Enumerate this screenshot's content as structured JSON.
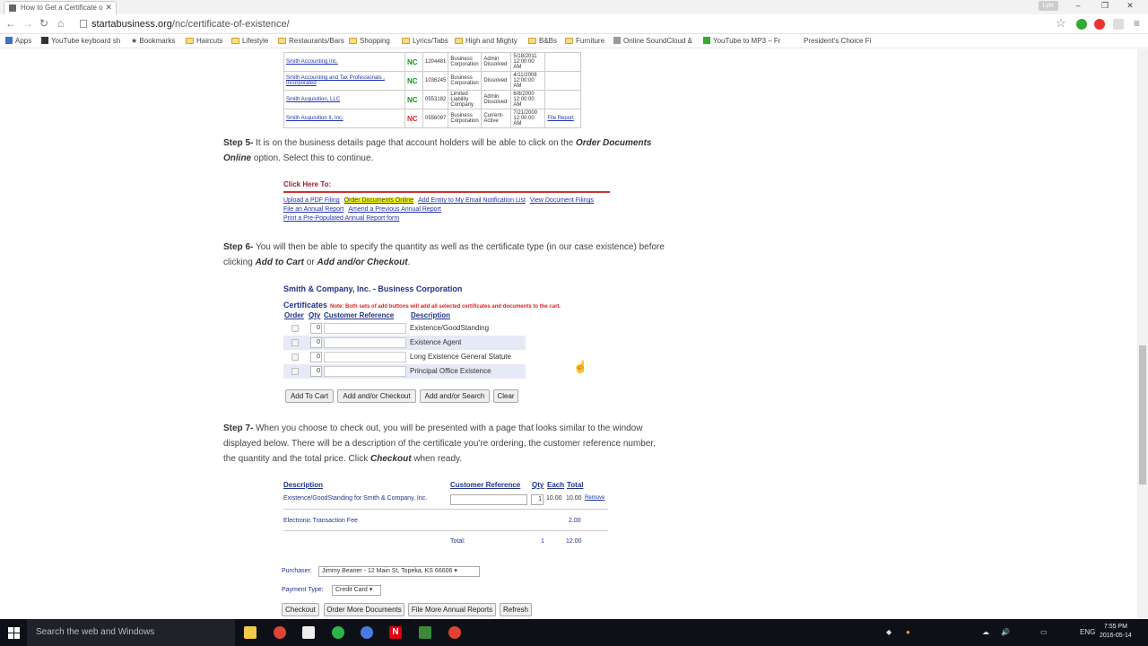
{
  "browser": {
    "tab_title": "How to Get a Certificate o",
    "tab_close": "✕",
    "window_user": "Lyle",
    "url_host": "startabusiness.org",
    "url_path": "/nc/certificate-of-existence/",
    "back_icon": "←",
    "forward_icon": "→",
    "reload_icon": "↻",
    "home_icon": "⌂",
    "star_icon": "☆",
    "menu_icon": "≡",
    "min_icon": "–",
    "max_icon": "❐",
    "close_icon": "✕"
  },
  "bookmarks": [
    {
      "label": "Apps",
      "icon": "apps-icon"
    },
    {
      "label": "YouTube keyboard sh",
      "icon": "youtube-icon"
    },
    {
      "label": "Bookmarks",
      "icon": "star-icon"
    },
    {
      "label": "Haircuts",
      "icon": "folder-icon"
    },
    {
      "label": "Lifestyle",
      "icon": "folder-icon"
    },
    {
      "label": "Restaurants/Bars",
      "icon": "folder-icon"
    },
    {
      "label": "Shopping",
      "icon": "folder-icon"
    },
    {
      "label": "Lyrics/Tabs",
      "icon": "folder-icon"
    },
    {
      "label": "High and Mighty",
      "icon": "folder-icon"
    },
    {
      "label": "B&Bs",
      "icon": "folder-icon"
    },
    {
      "label": "Furniture",
      "icon": "folder-icon"
    },
    {
      "label": "Online SoundCloud &",
      "icon": "page-icon"
    },
    {
      "label": "YouTube to MP3 – Fr",
      "icon": "page-icon"
    },
    {
      "label": "President's Choice Fi",
      "icon": "page-icon"
    }
  ],
  "results_table": [
    {
      "name": "Smith Accounting Inc.",
      "state": "NC",
      "id": "1204481",
      "type": "Business Corporation",
      "status": "Admin Dissolved",
      "date": "5/18/2011 12:00:00 AM",
      "action": ""
    },
    {
      "name": "Smith Accounting and Tax Professionals , Incorporated",
      "state": "NC",
      "id": "1036245",
      "type": "Business Corporation",
      "status": "Dissolved",
      "date": "4/11/2008 12:00:00 AM",
      "action": ""
    },
    {
      "name": "Smith Acquisition, LLC",
      "state": "NC",
      "id": "0553182",
      "type": "Limited Liability Company",
      "status": "Admin Dissolved",
      "date": "6/8/2000 12:00:00 AM",
      "action": ""
    },
    {
      "name": "Smith Acquisition II, Inc.",
      "state": "NC",
      "id": "0556097",
      "type": "Business Corporation",
      "status": "Current-Active",
      "date": "7/21/2000 12:00:00 AM",
      "action": "File Report"
    }
  ],
  "step5": {
    "label": "Step 5-",
    "text1": " It is on the business details page that account holders will be able to click on the ",
    "bold1": "Order Documents Online",
    "text2": " option. Select this to continue."
  },
  "click_here": {
    "title": "Click Here To:",
    "links_row1": [
      "Upload a PDF Filing",
      "Order Documents Online",
      "Add Entity to My Email Notification List",
      "View Document Filings"
    ],
    "links_row2": [
      "File an Annual Report",
      "Amend a Previous Annual Report"
    ],
    "links_row3": [
      "Print a Pre-Populated Annual Report form"
    ]
  },
  "step6": {
    "label": "Step 6-",
    "text1": " You will then be able to specify the quantity as well as the certificate type (in our case existence) before clicking ",
    "bold1": "Add to Cart",
    "text2": " or ",
    "bold2": "Add and/or Checkout",
    "text3": "."
  },
  "certificates": {
    "company": "Smith & Company, Inc. - Business Corporation",
    "heading": "Certificates",
    "note": "Note: Both sets of add buttons will add all selected certificates and documents to the cart.",
    "columns": [
      "Order",
      "Qty",
      "Customer Reference",
      "Description"
    ],
    "rows": [
      {
        "qty": "0",
        "description": "Existence/GoodStanding"
      },
      {
        "qty": "0",
        "description": "Existence Agent"
      },
      {
        "qty": "0",
        "description": "Long Existence General Statute"
      },
      {
        "qty": "0",
        "description": "Principal Office Existence"
      }
    ],
    "buttons": [
      "Add To Cart",
      "Add and/or Checkout",
      "Add and/or Search",
      "Clear"
    ]
  },
  "step7": {
    "label": "Step 7-",
    "text1": " When you choose to check out, you will be presented with a page that looks similar to the window displayed below. There will be a description of the certificate you're ordering, the customer reference number, the quantity and the total price. Click ",
    "bold1": "Checkout",
    "text2": " when ready."
  },
  "cart": {
    "columns": [
      "Description",
      "Customer Reference",
      "Qty",
      "Each",
      "Total"
    ],
    "item": {
      "description": "Existence/GoodStanding for Smith & Company, Inc.",
      "qty": "1",
      "each": "10.00",
      "total": "10.00",
      "remove": "Remove"
    },
    "fee": {
      "description": "Electronic Transaction Fee",
      "total": "2.00"
    },
    "total_row": {
      "label": "Total:",
      "qty": "1",
      "total": "12.00"
    },
    "purchaser_label": "Purchaser:",
    "purchaser_value": "Jimmy Beaner - 12 Main St, Topeka, KS 66606",
    "payment_label": "Payment Type:",
    "payment_value": "Credit Card",
    "buttons": [
      "Checkout",
      "Order More Documents",
      "File More Annual Reports",
      "Refresh"
    ]
  },
  "taskbar": {
    "search_placeholder": "Search the web and Windows",
    "lang": "ENG",
    "time": "7:55 PM",
    "date": "2016-05-14"
  }
}
